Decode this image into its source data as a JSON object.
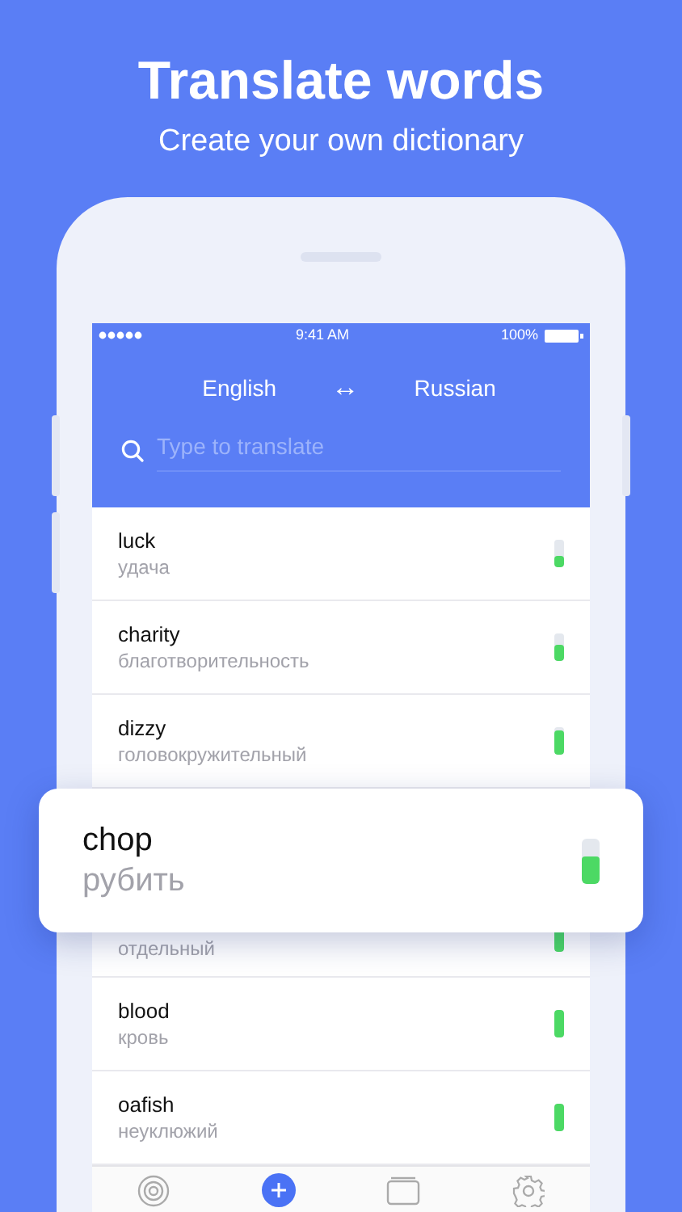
{
  "headline": "Translate words",
  "subheadline": "Create your own dictionary",
  "status_bar": {
    "time": "9:41 AM",
    "battery": "100%"
  },
  "languages": {
    "source": "English",
    "swap": "↔",
    "target": "Russian"
  },
  "search": {
    "placeholder": "Type to translate"
  },
  "words": [
    {
      "kind": "full",
      "word": "luck",
      "translation": "удача",
      "level": 0.4
    },
    {
      "kind": "full",
      "word": "charity",
      "translation": "благотворительность",
      "level": 0.6
    },
    {
      "kind": "full",
      "word": "dizzy",
      "translation": "головокружительный",
      "level": 0.9
    },
    {
      "kind": "partial",
      "translation": "отдельный",
      "level": 1
    },
    {
      "kind": "full",
      "word": "blood",
      "translation": "кровь",
      "level": 1
    },
    {
      "kind": "full",
      "word": "oafish",
      "translation": "неуклюжий",
      "level": 1
    }
  ],
  "highlighted": {
    "word": "chop",
    "translation": "рубить",
    "level": 0.6
  }
}
